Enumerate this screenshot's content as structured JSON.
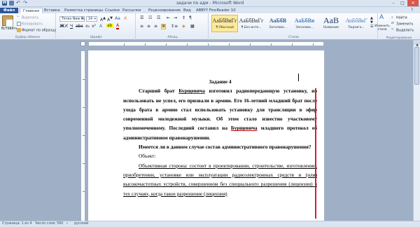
{
  "window": {
    "title": "задачи по адм - Microsoft Word",
    "app_icon": "W"
  },
  "tabs": [
    "Файл",
    "Главная",
    "Вставка",
    "Разметка страницы",
    "Ссылки",
    "Рассылки",
    "Рецензирование",
    "Вид",
    "ABBYY FineReader 10"
  ],
  "ribbon": {
    "clipboard": {
      "paste": "Вставить",
      "cut": "Вырезать",
      "copy": "Копировать",
      "format_painter": "Формат по образцу",
      "group_label": "Буфер обмена"
    },
    "font": {
      "font_name": "Times New Ro",
      "font_size": "14",
      "group_label": "Шрифт"
    },
    "paragraph": {
      "group_label": "Абзац"
    },
    "styles": {
      "items": [
        {
          "sample": "АаБбВвГг",
          "name": "¶ Обычный"
        },
        {
          "sample": "АаБбВвГг",
          "name": "¶ Без инте..."
        },
        {
          "sample": "АаБбВ",
          "name": "Заголово..."
        },
        {
          "sample": "АаБбВв",
          "name": "Заголово..."
        },
        {
          "sample": "AaB",
          "name": "Название"
        },
        {
          "sample": "АаБбВвГ",
          "name": "Подзаго..."
        }
      ],
      "change_styles": "Изменить стили",
      "group_label": "Стили"
    },
    "editing": {
      "find": "Найти",
      "replace": "Заменить",
      "select": "Выделить",
      "group_label": "Редактирование"
    }
  },
  "document": {
    "heading": "Задание 4",
    "p1_a": "Старший брат ",
    "p1_name": "Бурщевича",
    "p1_b": " изготовил радиопередающую установку, но использовать не успел, его призвали в армию. Его 16-летний младший брат после ухода брата в армию стал использовать установку для трансляции в эфир современной молодежной музыки. Об этом стало известно участковому уполномоченному. Последний составил на ",
    "p1_name2": "Бурщевича",
    "p1_c": " младшего протокол об административном правонарушении.",
    "p2": "Имеется ли в данном случае состав административного правонарушения?",
    "p3": "Объект:",
    "p4": "Объективная сторона: состоит в проектировании, строительстве, изготовлении, приобретении, установке или эксплуатации радиоэлектронных средств и (или) высокочастотных устройств, совершенном без специального разрешения (лицензии) в тех случаях, когда такое разрешение (лицензия)"
  },
  "status": {
    "page": "Страница: 1 из 4",
    "words": "Число слов: 560",
    "language": "русский"
  },
  "colors": {
    "file_tab": "#2b579a",
    "selection_bar": "#d02030"
  }
}
